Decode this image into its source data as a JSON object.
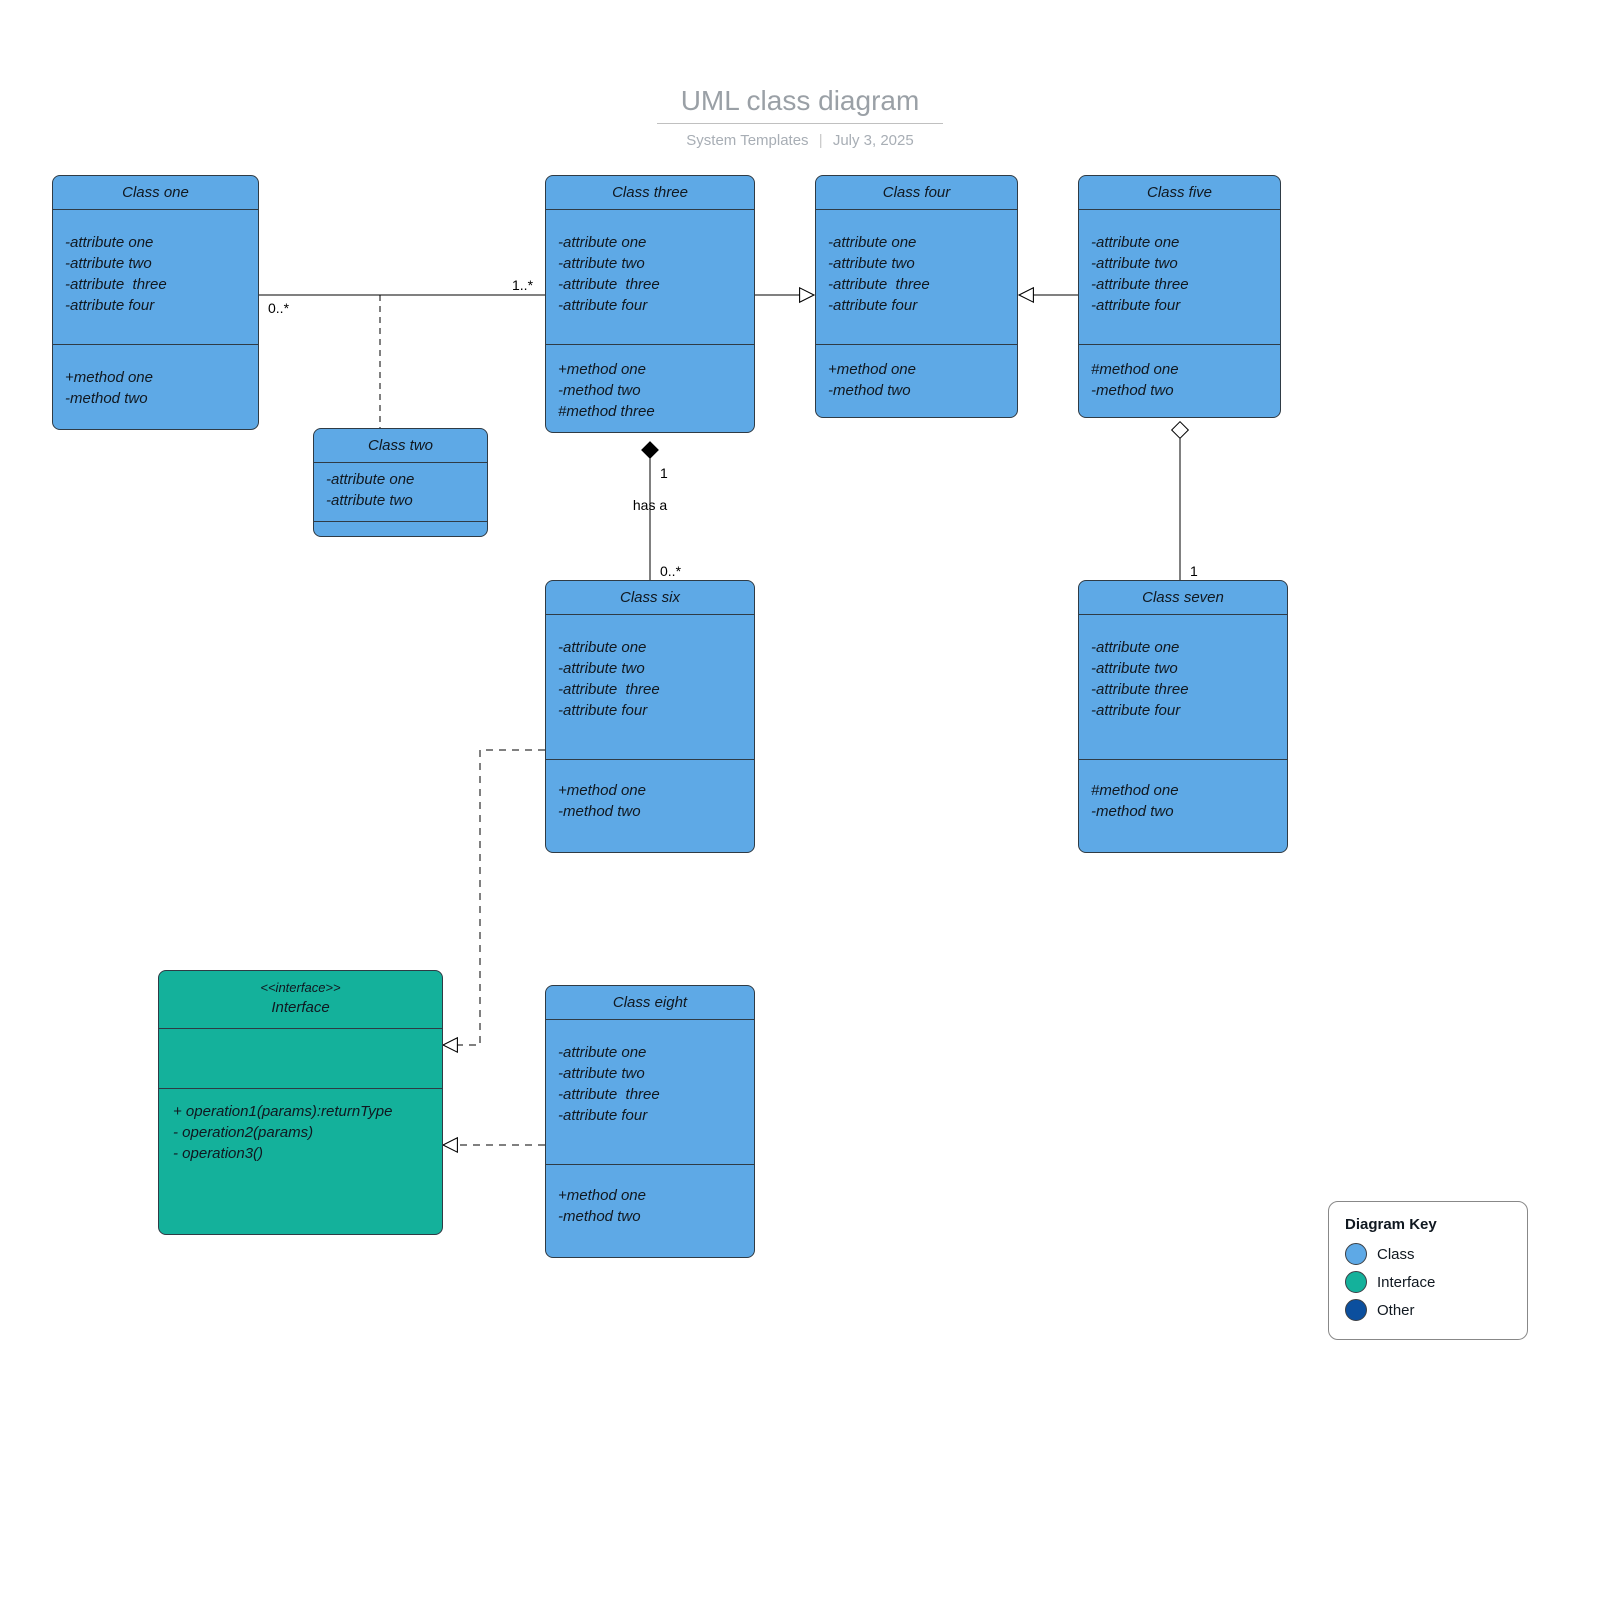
{
  "header": {
    "title": "UML class diagram",
    "author": "System Templates",
    "date": "July 3, 2025"
  },
  "legend": {
    "title": "Diagram Key",
    "items": [
      {
        "label": "Class",
        "kind": "class"
      },
      {
        "label": "Interface",
        "kind": "interface"
      },
      {
        "label": "Other",
        "kind": "other"
      }
    ]
  },
  "classes": {
    "one": {
      "name": "Class one",
      "attrs": [
        "-attribute one",
        "-attribute two",
        "-attribute  three",
        "-attribute four"
      ],
      "methods": [
        "+method one",
        "-method two"
      ]
    },
    "two": {
      "name": "Class two",
      "attrs": [
        "-attribute one",
        "-attribute two"
      ],
      "methods": []
    },
    "three": {
      "name": "Class three",
      "attrs": [
        "-attribute one",
        "-attribute two",
        "-attribute  three",
        "-attribute four"
      ],
      "methods": [
        "+method one",
        "-method two",
        "#method three"
      ]
    },
    "four": {
      "name": "Class four",
      "attrs": [
        "-attribute one",
        "-attribute two",
        "-attribute  three",
        "-attribute four"
      ],
      "methods": [
        "+method one",
        "-method two"
      ]
    },
    "five": {
      "name": "Class five",
      "attrs": [
        "-attribute one",
        "-attribute two",
        "-attribute three",
        "-attribute four"
      ],
      "methods": [
        "#method one",
        "-method two"
      ]
    },
    "six": {
      "name": "Class six",
      "attrs": [
        "-attribute one",
        "-attribute two",
        "-attribute  three",
        "-attribute four"
      ],
      "methods": [
        "+method one",
        "-method two"
      ]
    },
    "seven": {
      "name": "Class seven",
      "attrs": [
        "-attribute one",
        "-attribute two",
        "-attribute three",
        "-attribute four"
      ],
      "methods": [
        "#method one",
        "-method two"
      ]
    },
    "eight": {
      "name": "Class eight",
      "attrs": [
        "-attribute one",
        "-attribute two",
        "-attribute  three",
        "-attribute four"
      ],
      "methods": [
        "+method one",
        "-method two"
      ]
    },
    "iface": {
      "stereotype": "<<interface>>",
      "name": "Interface",
      "ops": [
        "+ operation1(params):returnType",
        "- operation2(params)",
        "- operation3()"
      ]
    }
  },
  "edges": {
    "one_three_left": "0..*",
    "one_three_right": "1..*",
    "three_six_top": "1",
    "three_six_label": "has a",
    "three_six_bottom": "0..*",
    "five_seven": "1"
  }
}
